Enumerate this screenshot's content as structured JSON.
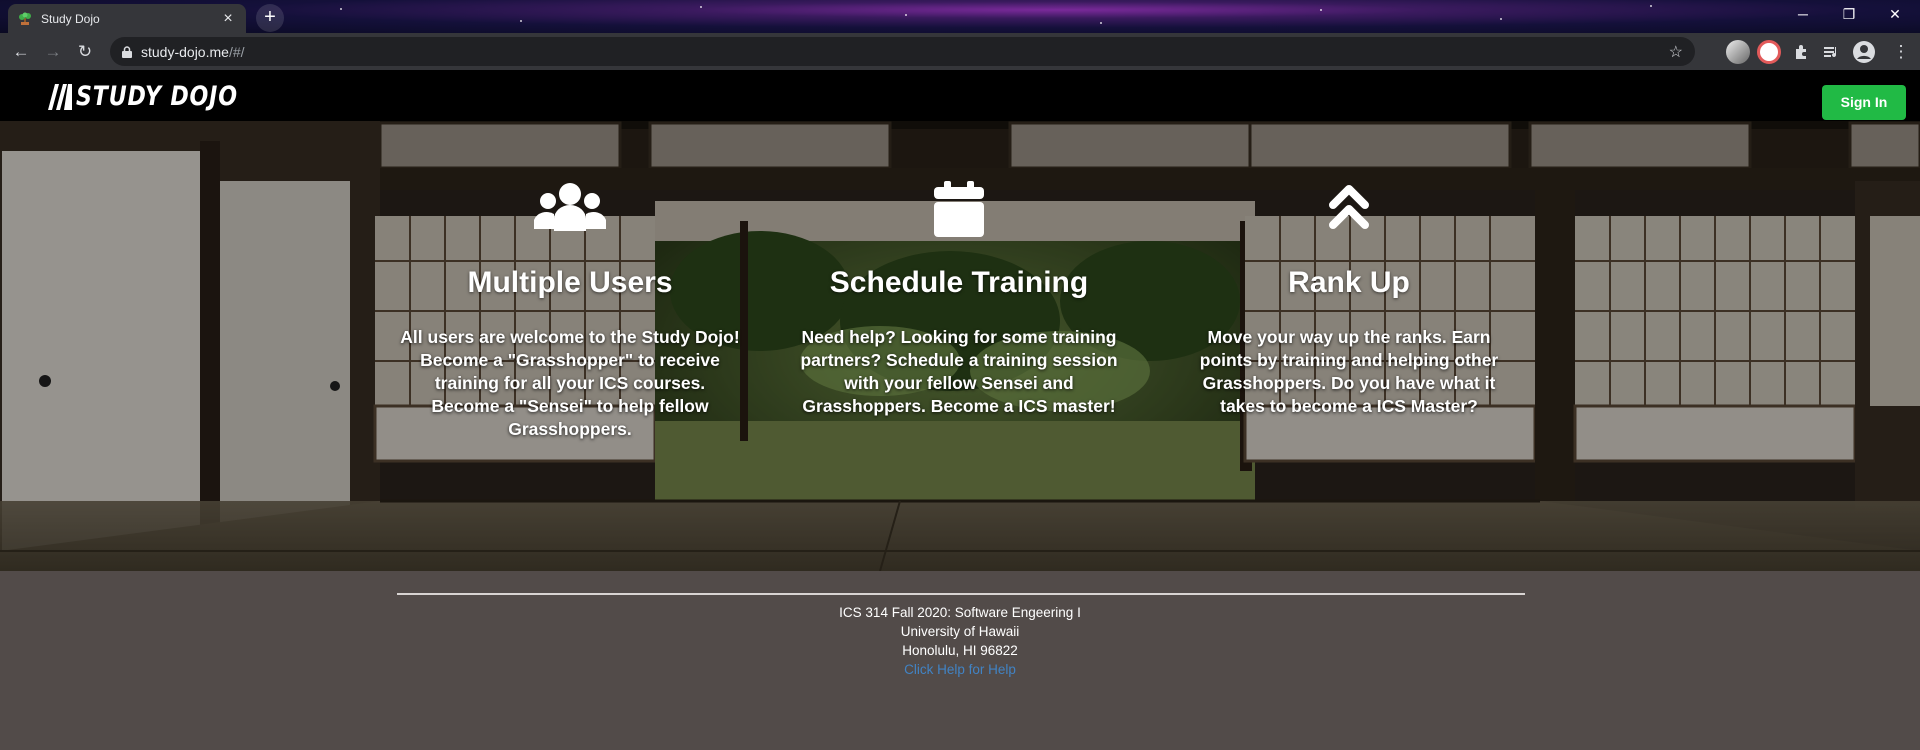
{
  "browser": {
    "tab_title": "Study Dojo",
    "url_host": "study-dojo.me",
    "url_path": "/#/"
  },
  "site": {
    "logo_text": "STUDY DOJO",
    "signin_label": "Sign In"
  },
  "features": [
    {
      "icon": "users-icon",
      "title": "Multiple Users",
      "text": "All users are welcome to the Study Dojo! Become a \"Grasshopper\" to receive training for all your ICS courses. Become a \"Sensei\" to help fellow Grasshoppers."
    },
    {
      "icon": "calendar-icon",
      "title": "Schedule Training",
      "text": "Need help? Looking for some training partners? Schedule a training session with your fellow Sensei and Grasshoppers. Become a ICS master!"
    },
    {
      "icon": "double-chevron-up-icon",
      "title": "Rank Up",
      "text": "Move your way up the ranks. Earn points by training and helping other Grasshoppers. Do you have what it takes to become a ICS Master?"
    }
  ],
  "footer": {
    "line1": "ICS 314 Fall 2020: Software Engeering I",
    "line2": "University of Hawaii",
    "line3": "Honolulu, HI 96822",
    "help_link": "Click Help for Help"
  },
  "colors": {
    "signin_bg": "#21ba45",
    "footer_bg": "#524b49",
    "link": "#4183c4"
  }
}
